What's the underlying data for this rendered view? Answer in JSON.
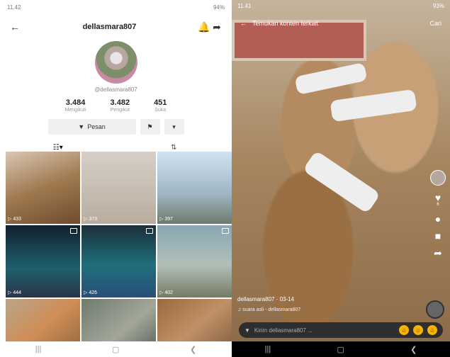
{
  "left": {
    "status_time": "11.42",
    "status_right": "94%",
    "profile_title": "dellasmara807",
    "handle": "@dellasmara807",
    "stats": [
      {
        "value": "3.484",
        "label": "Mengikuti"
      },
      {
        "value": "3.482",
        "label": "Pengikut"
      },
      {
        "value": "451",
        "label": "Suka"
      }
    ],
    "message_label": "Pesan",
    "grid": [
      {
        "count": "433",
        "pinned": false
      },
      {
        "count": "373",
        "pinned": false
      },
      {
        "count": "397",
        "pinned": false
      },
      {
        "count": "444",
        "pinned": true
      },
      {
        "count": "426",
        "pinned": true
      },
      {
        "count": "402",
        "pinned": true
      },
      {
        "count": "",
        "pinned": false
      },
      {
        "count": "",
        "pinned": false
      },
      {
        "count": "",
        "pinned": false
      }
    ]
  },
  "right": {
    "status_time": "11.41",
    "status_right": "93%",
    "top_title": "Temukan konten terkait",
    "top_right": "Cari",
    "username": "dellasmara807 · 03-14",
    "music": "♫ suara asli - dellasmara807",
    "comment_placeholder": "Kirim dellasmara807 ...",
    "rail_counts": [
      "6",
      "",
      "",
      ""
    ]
  },
  "colors": {
    "accent": "#fe2c55",
    "dark": "#111111"
  }
}
